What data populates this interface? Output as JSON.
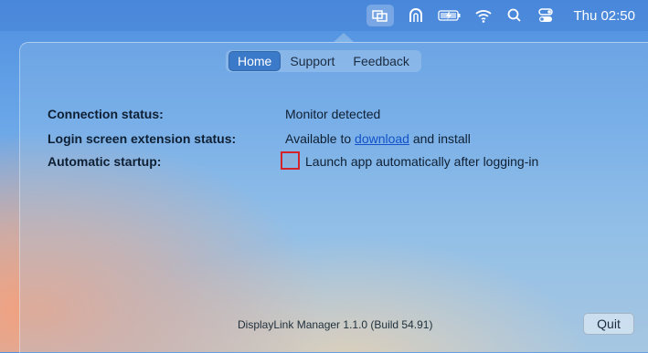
{
  "menubar": {
    "icons": [
      "display-mirror-icon",
      "vpn-shield-icon",
      "battery-charging-icon",
      "wifi-icon",
      "search-icon",
      "control-center-icon"
    ],
    "clock": "Thu 02:50"
  },
  "tabs": [
    {
      "label": "Home",
      "selected": true
    },
    {
      "label": "Support",
      "selected": false
    },
    {
      "label": "Feedback",
      "selected": false
    }
  ],
  "status": {
    "connection_label": "Connection status:",
    "connection_value": "Monitor detected",
    "login_label": "Login screen extension status:",
    "login_prefix": "Available to",
    "login_link": "download",
    "login_suffix": "and install",
    "startup_label": "Automatic startup:",
    "startup_checkbox_label": "Launch app automatically after logging-in",
    "startup_checked": false
  },
  "footer": {
    "version": "DisplayLink Manager 1.1.0 (Build 54.91)",
    "quit_label": "Quit"
  },
  "colors": {
    "accent": "#3b79c9",
    "link": "#1352c9",
    "highlight_box": "#d6232a"
  }
}
